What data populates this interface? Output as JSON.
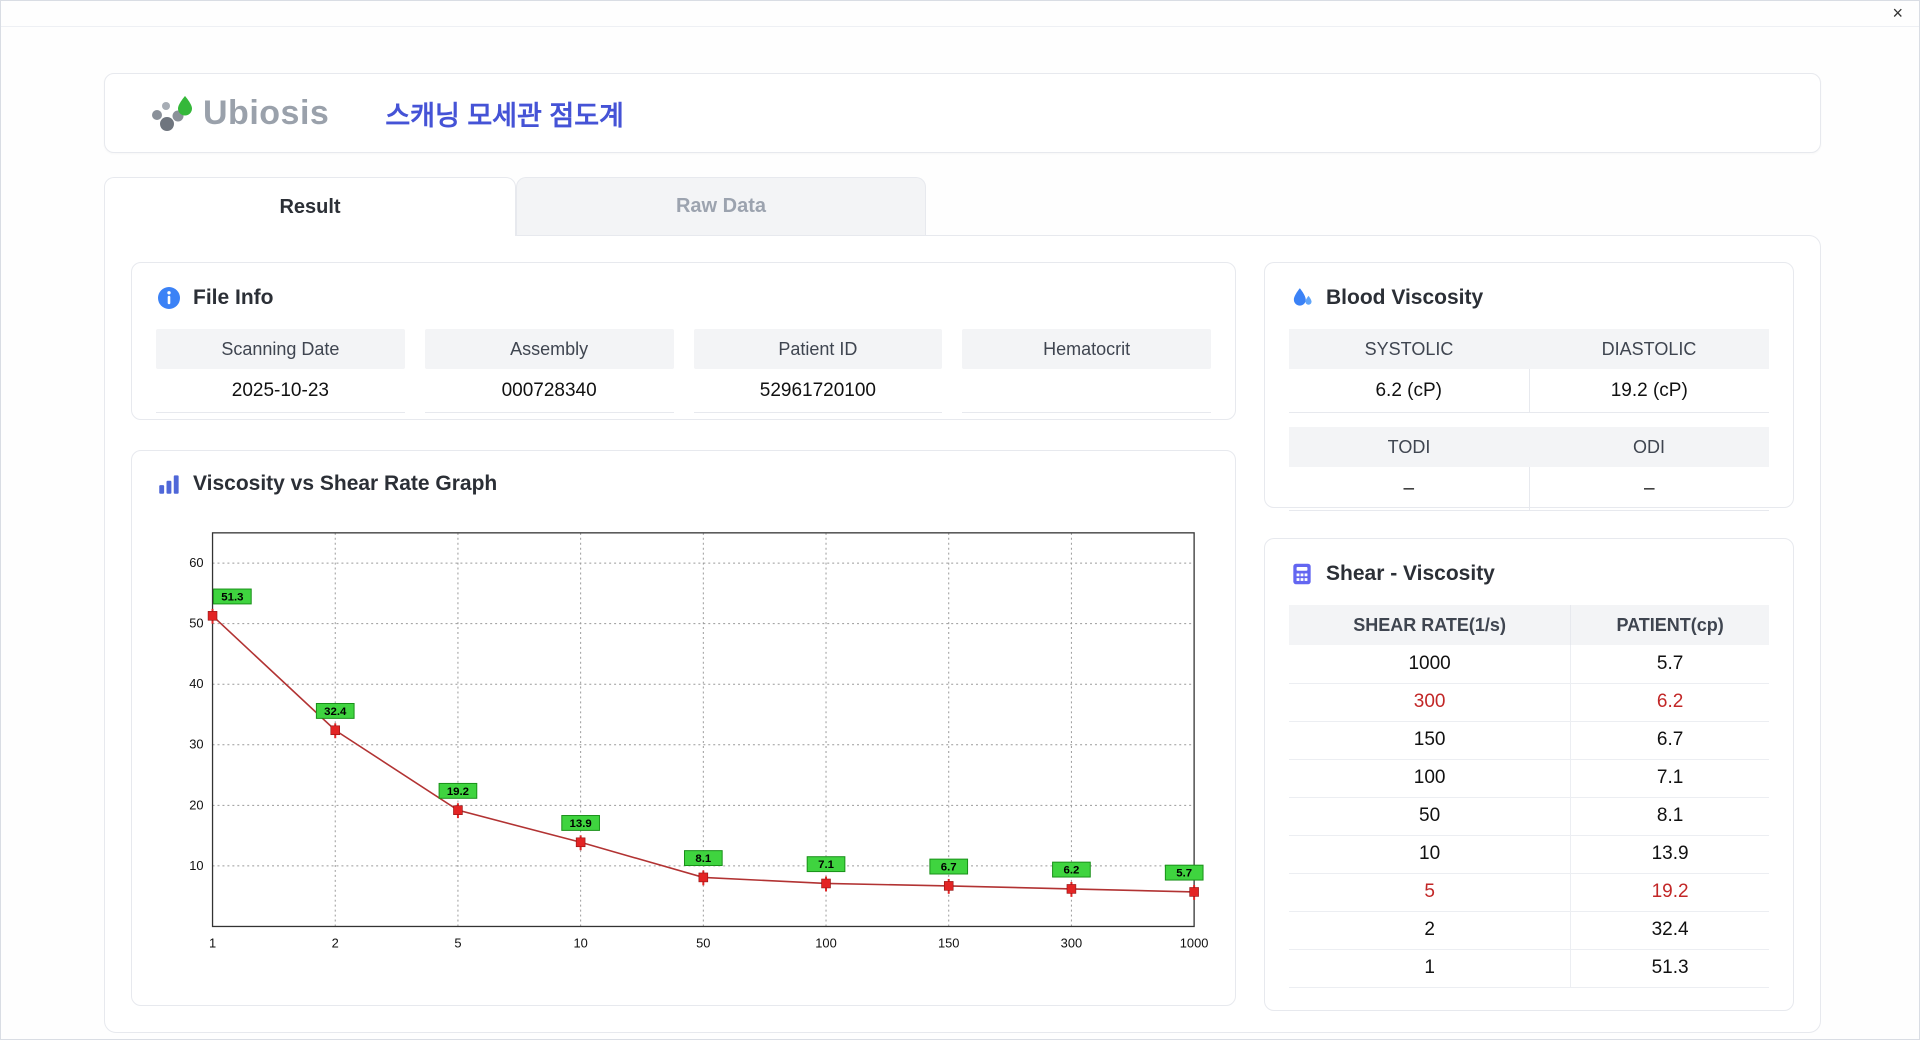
{
  "window": {
    "close_label": "×"
  },
  "header": {
    "brand": "Ubiosis",
    "title": "스캐닝 모세관 점도계"
  },
  "tabs": [
    {
      "label": "Result",
      "active": true
    },
    {
      "label": "Raw Data",
      "active": false
    }
  ],
  "file_info": {
    "title": "File Info",
    "fields": [
      {
        "label": "Scanning Date",
        "value": "2025-10-23"
      },
      {
        "label": "Assembly",
        "value": "000728340"
      },
      {
        "label": "Patient ID",
        "value": "52961720100"
      },
      {
        "label": "Hematocrit",
        "value": ""
      }
    ]
  },
  "blood_viscosity": {
    "title": "Blood Viscosity",
    "rows": [
      {
        "cols": [
          {
            "label": "SYSTOLIC",
            "value": "6.2 (cP)"
          },
          {
            "label": "DIASTOLIC",
            "value": "19.2 (cP)"
          }
        ]
      },
      {
        "cols": [
          {
            "label": "TODI",
            "value": "–"
          },
          {
            "label": "ODI",
            "value": "–"
          }
        ]
      }
    ]
  },
  "graph": {
    "title": "Viscosity vs Shear Rate Graph"
  },
  "shear_table": {
    "title": "Shear - Viscosity",
    "headers": [
      "SHEAR RATE(1/s)",
      "PATIENT(cp)"
    ],
    "rows": [
      {
        "rate": "1000",
        "value": "5.7",
        "highlight": false
      },
      {
        "rate": "300",
        "value": "6.2",
        "highlight": true
      },
      {
        "rate": "150",
        "value": "6.7",
        "highlight": false
      },
      {
        "rate": "100",
        "value": "7.1",
        "highlight": false
      },
      {
        "rate": "50",
        "value": "8.1",
        "highlight": false
      },
      {
        "rate": "10",
        "value": "13.9",
        "highlight": false
      },
      {
        "rate": "5",
        "value": "19.2",
        "highlight": true
      },
      {
        "rate": "2",
        "value": "32.4",
        "highlight": false
      },
      {
        "rate": "1",
        "value": "51.3",
        "highlight": false
      }
    ]
  },
  "chart_data": {
    "type": "line",
    "title": "Viscosity vs Shear Rate Graph",
    "x_labels": [
      "1",
      "2",
      "5",
      "10",
      "50",
      "100",
      "150",
      "300",
      "1000"
    ],
    "values": [
      51.3,
      32.4,
      19.2,
      13.9,
      8.1,
      7.1,
      6.7,
      6.2,
      5.7
    ],
    "yticks": [
      10,
      20,
      30,
      40,
      50,
      60
    ],
    "ylim": [
      0,
      65
    ],
    "xlabel": "",
    "ylabel": "",
    "grid": true,
    "x_scale": "log-categorical",
    "line_color": "#b23333",
    "marker_color": "#e32424",
    "label_bg": "#3fd43f",
    "label_border": "#189018"
  },
  "colors": {
    "accent_blue": "#3b82f6",
    "title_blue": "#4553d6",
    "highlight_red": "#c22727",
    "label_green": "#3fd43f"
  }
}
